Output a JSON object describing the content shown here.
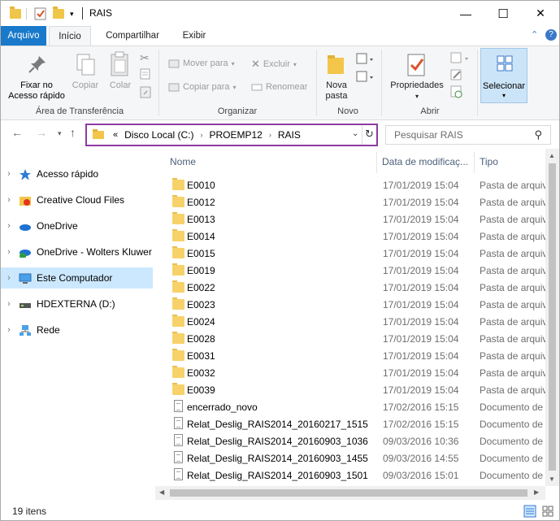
{
  "window": {
    "title": "RAIS",
    "controls": {
      "minimize": "—",
      "maximize": "☐",
      "close": "✕"
    }
  },
  "tabs": {
    "file": "Arquivo",
    "items": [
      "Início",
      "Compartilhar",
      "Exibir"
    ],
    "active": "Início"
  },
  "ribbon": {
    "clipboard": {
      "group": "Área de Transferência",
      "pin": "Fixar no\nAcesso rápido",
      "pin_line1": "Fixar no",
      "pin_line2": "Acesso rápido",
      "copy": "Copiar",
      "paste": "Colar"
    },
    "organize": {
      "group": "Organizar",
      "move_to": "Mover para",
      "copy_to": "Copiar para",
      "delete": "Excluir",
      "rename": "Renomear"
    },
    "new": {
      "group": "Novo",
      "new_folder_line1": "Nova",
      "new_folder_line2": "pasta"
    },
    "open": {
      "group": "Abrir",
      "properties": "Propriedades"
    },
    "select": {
      "label": "Selecionar"
    }
  },
  "address": {
    "overflow": "«",
    "crumbs": [
      "Disco Local (C:)",
      "PROEMP12",
      "RAIS"
    ],
    "search_placeholder": "Pesquisar RAIS"
  },
  "navpane": {
    "items": [
      {
        "label": "Acesso rápido",
        "icon": "star-icon"
      },
      {
        "label": "Creative Cloud Files",
        "icon": "creative-cloud-icon"
      },
      {
        "label": "OneDrive",
        "icon": "cloud-icon"
      },
      {
        "label": "OneDrive - Wolters Kluwer",
        "icon": "cloud-icon"
      },
      {
        "label": "Este Computador",
        "icon": "computer-icon",
        "selected": true
      },
      {
        "label": "HDEXTERNA (D:)",
        "icon": "drive-icon"
      },
      {
        "label": "Rede",
        "icon": "network-icon"
      }
    ]
  },
  "columns": {
    "name": "Nome",
    "date": "Data de modificaç...",
    "type": "Tipo"
  },
  "files": [
    {
      "name": "E0010",
      "date": "17/01/2019 15:04",
      "type": "Pasta de arquivos",
      "kind": "folder"
    },
    {
      "name": "E0012",
      "date": "17/01/2019 15:04",
      "type": "Pasta de arquivos",
      "kind": "folder"
    },
    {
      "name": "E0013",
      "date": "17/01/2019 15:04",
      "type": "Pasta de arquivos",
      "kind": "folder"
    },
    {
      "name": "E0014",
      "date": "17/01/2019 15:04",
      "type": "Pasta de arquivos",
      "kind": "folder"
    },
    {
      "name": "E0015",
      "date": "17/01/2019 15:04",
      "type": "Pasta de arquivos",
      "kind": "folder"
    },
    {
      "name": "E0019",
      "date": "17/01/2019 15:04",
      "type": "Pasta de arquivos",
      "kind": "folder"
    },
    {
      "name": "E0022",
      "date": "17/01/2019 15:04",
      "type": "Pasta de arquivos",
      "kind": "folder"
    },
    {
      "name": "E0023",
      "date": "17/01/2019 15:04",
      "type": "Pasta de arquivos",
      "kind": "folder"
    },
    {
      "name": "E0024",
      "date": "17/01/2019 15:04",
      "type": "Pasta de arquivos",
      "kind": "folder"
    },
    {
      "name": "E0028",
      "date": "17/01/2019 15:04",
      "type": "Pasta de arquivos",
      "kind": "folder"
    },
    {
      "name": "E0031",
      "date": "17/01/2019 15:04",
      "type": "Pasta de arquivos",
      "kind": "folder"
    },
    {
      "name": "E0032",
      "date": "17/01/2019 15:04",
      "type": "Pasta de arquivos",
      "kind": "folder"
    },
    {
      "name": "E0039",
      "date": "17/01/2019 15:04",
      "type": "Pasta de arquivos",
      "kind": "folder"
    },
    {
      "name": "encerrado_novo",
      "date": "17/02/2016 15:15",
      "type": "Documento de texto",
      "kind": "doc"
    },
    {
      "name": "Relat_Deslig_RAIS2014_20160217_1515",
      "date": "17/02/2016 15:15",
      "type": "Documento de texto",
      "kind": "doc"
    },
    {
      "name": "Relat_Deslig_RAIS2014_20160903_1036",
      "date": "09/03/2016 10:36",
      "type": "Documento de texto",
      "kind": "doc"
    },
    {
      "name": "Relat_Deslig_RAIS2014_20160903_1455",
      "date": "09/03/2016 14:55",
      "type": "Documento de texto",
      "kind": "doc"
    },
    {
      "name": "Relat_Deslig_RAIS2014_20160903_1501",
      "date": "09/03/2016 15:01",
      "type": "Documento de texto",
      "kind": "doc"
    }
  ],
  "status": {
    "count": "19 itens"
  },
  "colors": {
    "accent": "#1979ca",
    "selection": "#cce8ff",
    "address_border": "#8e3aa3"
  }
}
